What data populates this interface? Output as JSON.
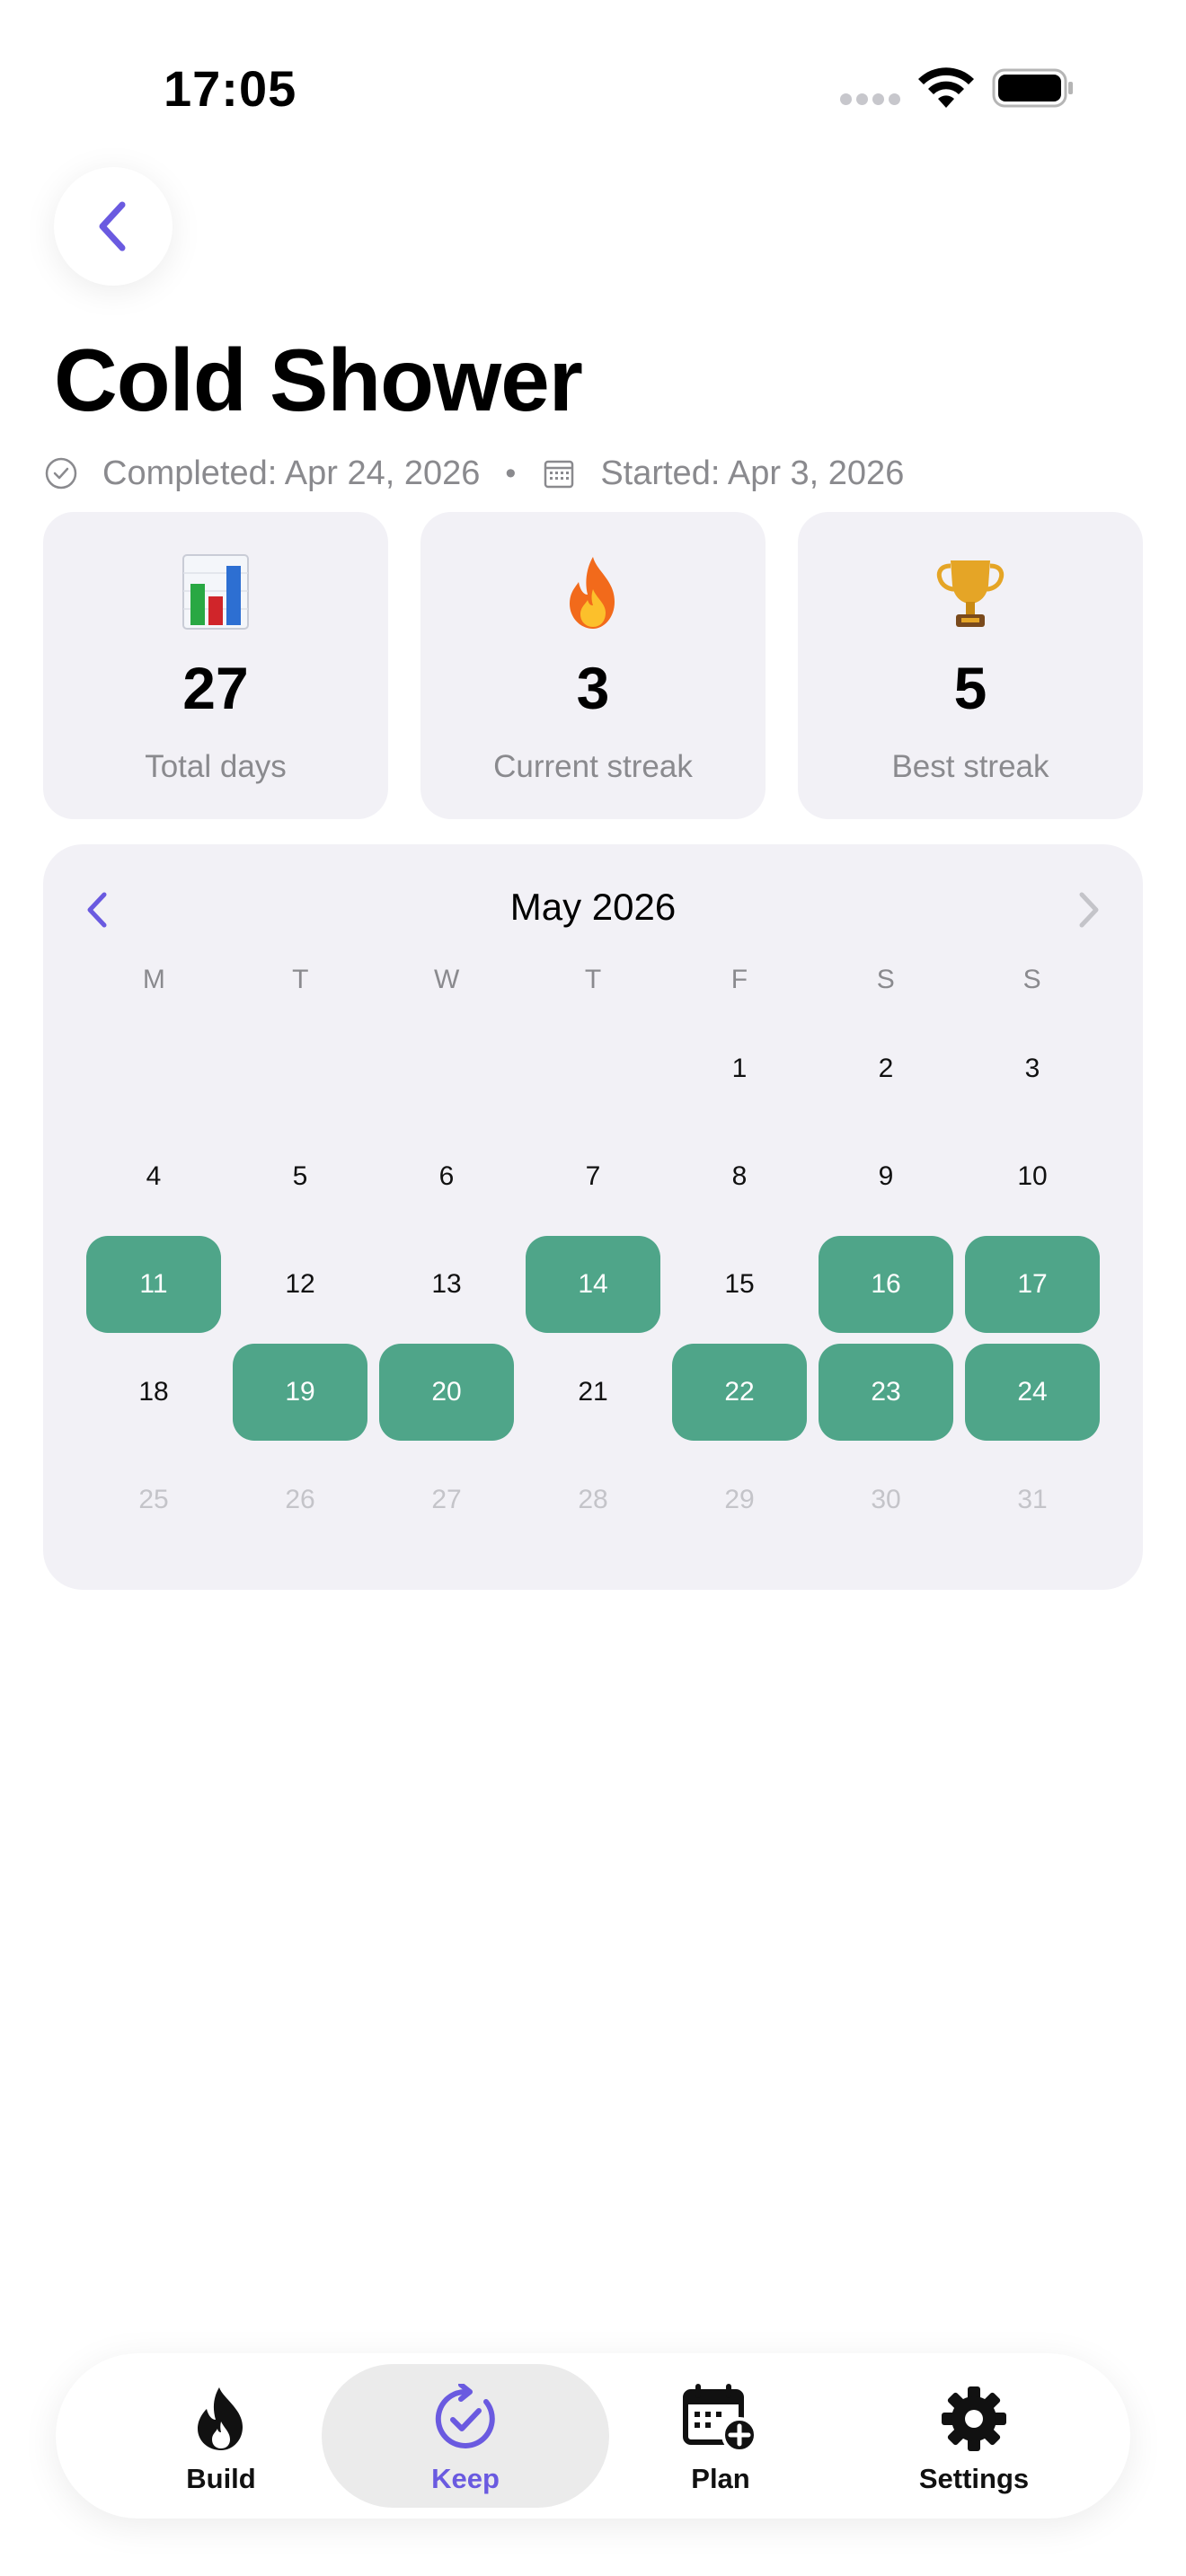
{
  "status_bar": {
    "time": "17:05"
  },
  "header": {
    "title": "Cold Shower"
  },
  "meta": {
    "completed": "Completed: Apr 24, 2026",
    "separator": "•",
    "started": "Started: Apr 3, 2026"
  },
  "stats": [
    {
      "icon": "bar-chart-emoji",
      "value": "27",
      "label": "Total days"
    },
    {
      "icon": "fire-emoji",
      "value": "3",
      "label": "Current streak"
    },
    {
      "icon": "trophy-emoji",
      "value": "5",
      "label": "Best streak"
    }
  ],
  "calendar": {
    "month_label": "May 2026",
    "weekdays": [
      "M",
      "T",
      "W",
      "T",
      "F",
      "S",
      "S"
    ],
    "leading_blanks": 4,
    "days": [
      {
        "n": "1",
        "state": "normal"
      },
      {
        "n": "2",
        "state": "normal"
      },
      {
        "n": "3",
        "state": "normal"
      },
      {
        "n": "4",
        "state": "normal"
      },
      {
        "n": "5",
        "state": "normal"
      },
      {
        "n": "6",
        "state": "normal"
      },
      {
        "n": "7",
        "state": "normal"
      },
      {
        "n": "8",
        "state": "normal"
      },
      {
        "n": "9",
        "state": "normal"
      },
      {
        "n": "10",
        "state": "normal"
      },
      {
        "n": "11",
        "state": "done"
      },
      {
        "n": "12",
        "state": "normal"
      },
      {
        "n": "13",
        "state": "normal"
      },
      {
        "n": "14",
        "state": "done"
      },
      {
        "n": "15",
        "state": "normal"
      },
      {
        "n": "16",
        "state": "done"
      },
      {
        "n": "17",
        "state": "done"
      },
      {
        "n": "18",
        "state": "normal"
      },
      {
        "n": "19",
        "state": "done"
      },
      {
        "n": "20",
        "state": "done"
      },
      {
        "n": "21",
        "state": "normal"
      },
      {
        "n": "22",
        "state": "done"
      },
      {
        "n": "23",
        "state": "done"
      },
      {
        "n": "24",
        "state": "done"
      },
      {
        "n": "25",
        "state": "future"
      },
      {
        "n": "26",
        "state": "future"
      },
      {
        "n": "27",
        "state": "future"
      },
      {
        "n": "28",
        "state": "future"
      },
      {
        "n": "29",
        "state": "future"
      },
      {
        "n": "30",
        "state": "future"
      },
      {
        "n": "31",
        "state": "future"
      }
    ]
  },
  "tab_bar": {
    "tabs": [
      {
        "label": "Build",
        "icon": "flame-icon",
        "active": false
      },
      {
        "label": "Keep",
        "icon": "refresh-check-icon",
        "active": true
      },
      {
        "label": "Plan",
        "icon": "calendar-plus-icon",
        "active": false
      },
      {
        "label": "Settings",
        "icon": "gear-icon",
        "active": false
      }
    ]
  },
  "colors": {
    "accent": "#6a5ae0",
    "completed_day": "#4fa589",
    "card_background": "#f2f1f6",
    "secondary_text": "#8a8a8e"
  }
}
